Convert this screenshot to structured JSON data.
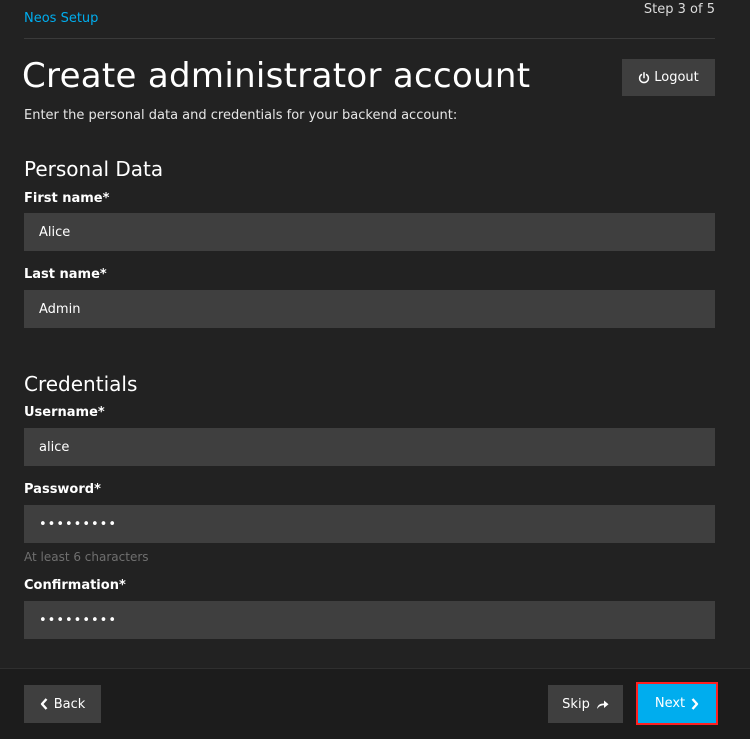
{
  "header": {
    "app_link": "Neos Setup",
    "step": "Step 3 of 5"
  },
  "page": {
    "title": "Create administrator account",
    "intro": "Enter the personal data and credentials for your backend account:",
    "logout_label": "Logout"
  },
  "personal_data": {
    "heading": "Personal Data",
    "first_name_label": "First name*",
    "first_name_value": "Alice",
    "last_name_label": "Last name*",
    "last_name_value": "Admin"
  },
  "credentials": {
    "heading": "Credentials",
    "username_label": "Username*",
    "username_value": "alice",
    "password_label": "Password*",
    "password_value": "•••••••••",
    "password_hint": "At least 6 characters",
    "confirmation_label": "Confirmation*",
    "confirmation_value": "•••••••••"
  },
  "footer": {
    "back_label": "Back",
    "skip_label": "Skip",
    "next_label": "Next"
  },
  "colors": {
    "background": "#222222",
    "input_background": "#3f3f3f",
    "accent": "#00adee",
    "link": "#00adee",
    "highlight_border": "#ff2020"
  },
  "icons": {
    "logout": "power-icon",
    "back": "chevron-left-icon",
    "skip": "share-arrow-icon",
    "next": "chevron-right-icon"
  }
}
